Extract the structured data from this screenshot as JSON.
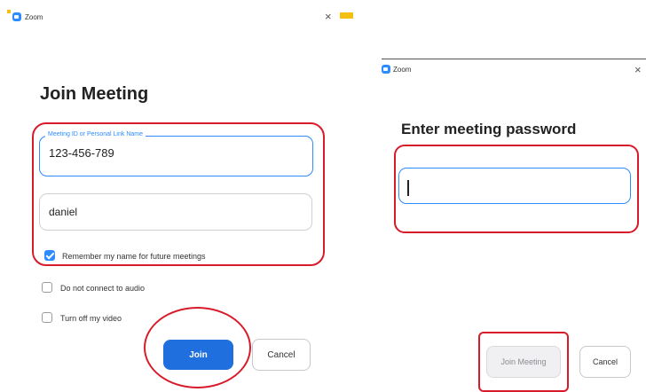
{
  "left_dialog": {
    "window_title": "Zoom",
    "close_glyph": "×",
    "heading": "Join Meeting",
    "meeting_id": {
      "label": "Meeting ID or Personal Link Name",
      "value": "123-456-789"
    },
    "name_field": {
      "value": "daniel"
    },
    "checkboxes": [
      {
        "label": "Remember my name for future meetings",
        "checked": true
      },
      {
        "label": "Do not connect to audio",
        "checked": false
      },
      {
        "label": "Turn off my video",
        "checked": false
      }
    ],
    "join_label": "Join",
    "cancel_label": "Cancel"
  },
  "right_dialog": {
    "window_title": "Zoom",
    "close_glyph": "×",
    "heading": "Enter meeting password",
    "password_value": "",
    "join_label": "Join Meeting",
    "cancel_label": "Cancel"
  },
  "colors": {
    "accent": "#2d8cff",
    "primary_button": "#1f6fde",
    "highlight": "#d81b2a",
    "marker_yellow": "#f3c012"
  }
}
